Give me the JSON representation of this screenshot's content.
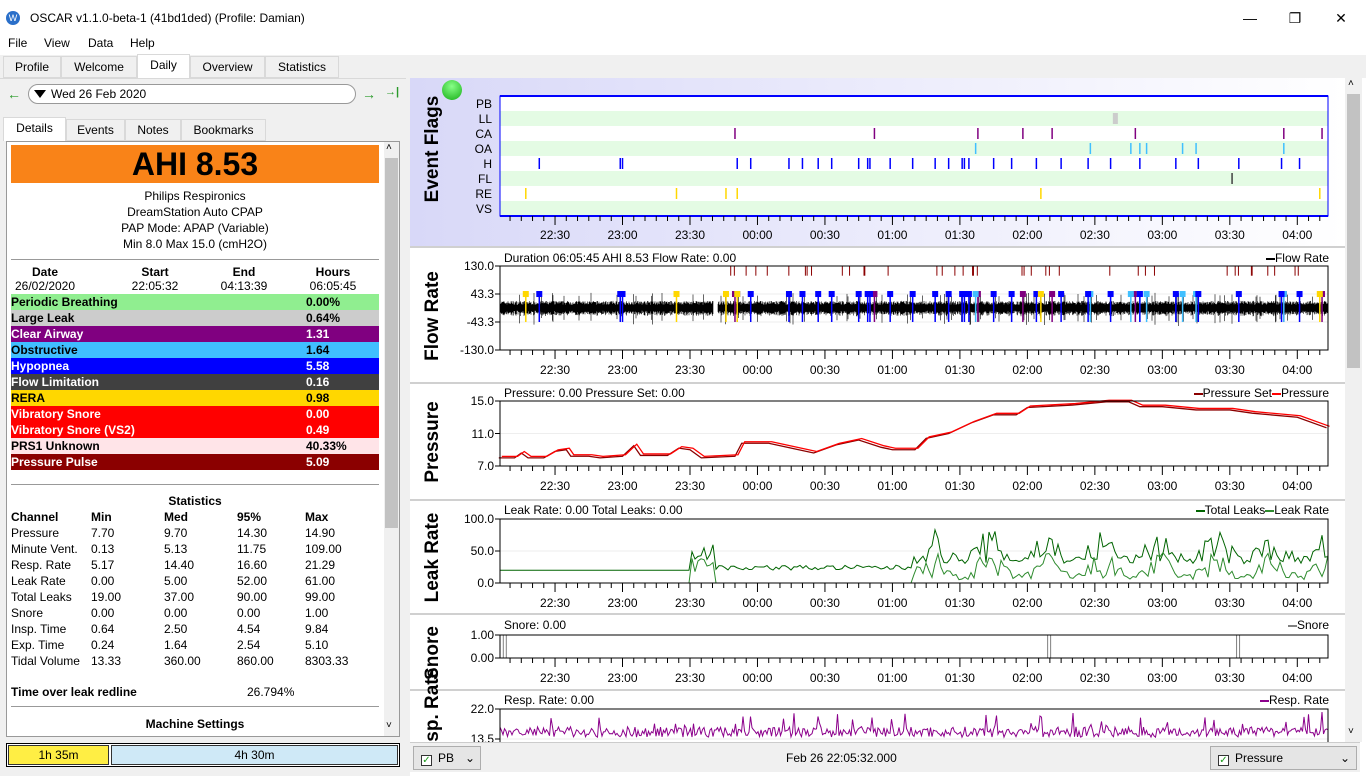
{
  "window": {
    "title": "OSCAR v1.1.0-beta-1 (41bd1ded) (Profile: Damian)",
    "minimize": "—",
    "maximize": "❐",
    "close": "✕"
  },
  "menu": [
    "File",
    "View",
    "Data",
    "Help"
  ],
  "main_tabs": [
    {
      "label": "Profile"
    },
    {
      "label": "Welcome"
    },
    {
      "label": "Daily",
      "active": true
    },
    {
      "label": "Overview"
    },
    {
      "label": "Statistics"
    }
  ],
  "date_nav": {
    "prev": "←",
    "date": "Wed 26 Feb 2020",
    "next": "→",
    "last": "→|"
  },
  "sub_tabs": [
    {
      "label": "Details",
      "active": true
    },
    {
      "label": "Events"
    },
    {
      "label": "Notes"
    },
    {
      "label": "Bookmarks"
    }
  ],
  "details": {
    "ahi": "AHI 8.53",
    "ahi_color": "#f98318",
    "machine": [
      "Philips Respironics",
      "DreamStation Auto CPAP",
      "PAP Mode: APAP (Variable)",
      "Min 8.0 Max 15.0 (cmH2O)"
    ],
    "session_headers": [
      "Date",
      "Start",
      "End",
      "Hours"
    ],
    "session_values": [
      "26/02/2020",
      "22:05:32",
      "04:13:39",
      "06:05:45"
    ],
    "events": [
      {
        "label": "Periodic Breathing",
        "value": "0.00%",
        "bg": "#90ee90",
        "fg": "#000000"
      },
      {
        "label": "Large Leak",
        "value": "0.64%",
        "bg": "#cccccc",
        "fg": "#000000"
      },
      {
        "label": "Clear Airway",
        "value": "1.31",
        "bg": "#800080",
        "fg": "#ffffff"
      },
      {
        "label": "Obstructive",
        "value": "1.64",
        "bg": "#40bfff",
        "fg": "#000000"
      },
      {
        "label": "Hypopnea",
        "value": "5.58",
        "bg": "#0000ff",
        "fg": "#ffffff"
      },
      {
        "label": "Flow Limitation",
        "value": "0.16",
        "bg": "#404040",
        "fg": "#ffffff"
      },
      {
        "label": "RERA",
        "value": "0.98",
        "bg": "#ffd700",
        "fg": "#000000"
      },
      {
        "label": "Vibratory Snore",
        "value": "0.00",
        "bg": "#ff0000",
        "fg": "#ffffff"
      },
      {
        "label": "Vibratory Snore (VS2)",
        "value": "0.49",
        "bg": "#ff0000",
        "fg": "#ffffff"
      },
      {
        "label": "PRS1 Unknown",
        "value": "40.33%",
        "bg": "#ffe4e8",
        "fg": "#000000"
      },
      {
        "label": "Pressure Pulse",
        "value": "5.09",
        "bg": "#8b0000",
        "fg": "#ffffff"
      }
    ],
    "stats_title": "Statistics",
    "stats_headers": [
      "Channel",
      "Min",
      "Med",
      "95%",
      "Max"
    ],
    "stats_rows": [
      [
        "Pressure",
        "7.70",
        "9.70",
        "14.30",
        "14.90"
      ],
      [
        "Minute Vent.",
        "0.13",
        "5.13",
        "11.75",
        "109.00"
      ],
      [
        "Resp. Rate",
        "5.17",
        "14.40",
        "16.60",
        "21.29"
      ],
      [
        "Leak Rate",
        "0.00",
        "5.00",
        "52.00",
        "61.00"
      ],
      [
        "Total Leaks",
        "19.00",
        "37.00",
        "90.00",
        "99.00"
      ],
      [
        "Snore",
        "0.00",
        "0.00",
        "0.00",
        "1.00"
      ],
      [
        "Insp. Time",
        "0.64",
        "2.50",
        "4.54",
        "9.84"
      ],
      [
        "Exp. Time",
        "0.24",
        "1.64",
        "2.54",
        "5.10"
      ],
      [
        "Tidal Volume",
        "13.33",
        "360.00",
        "860.00",
        "8303.33"
      ]
    ],
    "leak_redline_label": "Time over leak redline",
    "leak_redline_value": "26.794%",
    "machine_settings": "Machine Settings"
  },
  "session_bars": [
    {
      "label": "1h 35m",
      "color": "#ffee44"
    },
    {
      "label": "4h 30m",
      "color": "#cfe9f7"
    }
  ],
  "time_axis": {
    "start": "22:05:32",
    "end": "04:13:39",
    "labels": [
      "22:30",
      "23:00",
      "23:30",
      "00:00",
      "00:30",
      "01:00",
      "01:30",
      "02:00",
      "02:30",
      "03:00",
      "03:30",
      "04:00"
    ]
  },
  "event_flags": {
    "title": "Event Flags",
    "channels": [
      "PB",
      "LL",
      "CA",
      "OA",
      "H",
      "FL",
      "RE",
      "VS"
    ],
    "colors": {
      "CA": "#800080",
      "OA": "#40bfff",
      "H": "#0000ff",
      "FL": "#404040",
      "RE": "#ffd700",
      "LL": "#cccccc"
    },
    "events": {
      "LL": [
        "02:38"
      ],
      "CA": [
        "23:50",
        "00:52",
        "01:38",
        "01:58",
        "02:11",
        "02:48",
        "03:54",
        "04:11"
      ],
      "OA": [
        "01:37",
        "02:28",
        "02:46",
        "02:50",
        "02:53",
        "03:09",
        "03:15",
        "03:54"
      ],
      "H": [
        "22:23",
        "22:59",
        "23:00",
        "23:51",
        "23:57",
        "00:14",
        "00:20",
        "00:27",
        "00:33",
        "00:45",
        "00:49",
        "00:50",
        "00:59",
        "01:09",
        "01:19",
        "01:25",
        "01:31",
        "01:32",
        "01:34",
        "01:45",
        "01:53",
        "02:04",
        "02:15",
        "02:27",
        "02:37",
        "02:50",
        "03:06",
        "03:16",
        "03:34",
        "03:53",
        "04:01"
      ],
      "FL": [
        "03:31"
      ],
      "RE": [
        "22:17",
        "23:24",
        "23:46",
        "23:51",
        "02:06",
        "04:10"
      ]
    }
  },
  "graphs": [
    {
      "id": "flow",
      "title": "Flow Rate",
      "header": "Duration 06:05:45 AHI 8.53 Flow Rate: 0.00",
      "legend": [
        {
          "label": "Flow Rate",
          "color": "#000000"
        }
      ],
      "yticks": [
        "130.0",
        "43.3",
        "-43.3",
        "-130.0"
      ],
      "ylim": [
        -130,
        130
      ],
      "color": "#000000"
    },
    {
      "id": "pressure",
      "title": "Pressure",
      "header": "Pressure: 0.00 Pressure Set: 0.00",
      "legend": [
        {
          "label": "Pressure Set",
          "color": "#8b0000"
        },
        {
          "label": "Pressure",
          "color": "#ff0000"
        }
      ],
      "yticks": [
        "15.0",
        "11.0",
        "7.0"
      ],
      "ylim": [
        7,
        15
      ],
      "series": [
        [
          "22:05",
          8.0
        ],
        [
          "22:12",
          8.0
        ],
        [
          "22:15",
          8.6
        ],
        [
          "22:18",
          8.0
        ],
        [
          "22:25",
          8.0
        ],
        [
          "22:30",
          8.8
        ],
        [
          "22:35",
          9.0
        ],
        [
          "22:37",
          8.2
        ],
        [
          "22:45",
          8.2
        ],
        [
          "22:50",
          8.0
        ],
        [
          "23:00",
          8.2
        ],
        [
          "23:05",
          9.5
        ],
        [
          "23:08",
          8.3
        ],
        [
          "23:20",
          8.3
        ],
        [
          "23:25",
          9.2
        ],
        [
          "23:30",
          9.0
        ],
        [
          "23:35",
          8.0
        ],
        [
          "23:50",
          8.2
        ],
        [
          "23:53",
          9.8
        ],
        [
          "00:05",
          9.8
        ],
        [
          "00:15",
          9.2
        ],
        [
          "00:25",
          8.6
        ],
        [
          "00:35",
          9.6
        ],
        [
          "00:45",
          10.2
        ],
        [
          "00:55",
          9.3
        ],
        [
          "01:00",
          9.0
        ],
        [
          "01:10",
          9.0
        ],
        [
          "01:15",
          10.4
        ],
        [
          "01:25",
          11.0
        ],
        [
          "01:35",
          12.3
        ],
        [
          "01:45",
          13.3
        ],
        [
          "01:55",
          13.3
        ],
        [
          "02:00",
          14.2
        ],
        [
          "02:20",
          14.5
        ],
        [
          "02:35",
          14.9
        ],
        [
          "02:45",
          14.9
        ],
        [
          "02:50",
          14.3
        ],
        [
          "03:00",
          14.3
        ],
        [
          "03:15",
          13.9
        ],
        [
          "03:30",
          13.9
        ],
        [
          "03:40",
          13.5
        ],
        [
          "04:00",
          13.0
        ],
        [
          "04:13",
          11.7
        ]
      ]
    },
    {
      "id": "leak",
      "title": "Leak Rate",
      "header": "Leak Rate: 0.00 Total Leaks: 0.00",
      "legend": [
        {
          "label": "Total Leaks",
          "color": "#006400"
        },
        {
          "label": "Leak Rate",
          "color": "#2e8b2e"
        }
      ],
      "yticks": [
        "100.0",
        "50.0",
        "0.0"
      ],
      "ylim": [
        0,
        100
      ]
    },
    {
      "id": "snore",
      "title": "Snore",
      "header": "Snore: 0.00",
      "legend": [
        {
          "label": "Snore",
          "color": "#808080"
        }
      ],
      "yticks": [
        "1.00",
        "0.00"
      ],
      "ylim": [
        0,
        1
      ],
      "spikes": [
        "22:07",
        "02:09",
        "03:33"
      ]
    },
    {
      "id": "resp",
      "title": "Resp. Rate",
      "header": "Resp. Rate: 0.00",
      "legend": [
        {
          "label": "Resp. Rate",
          "color": "#8b008b"
        }
      ],
      "yticks": [
        "22.0",
        "13.5"
      ],
      "ylim": [
        5,
        22
      ]
    }
  ],
  "statusbar": {
    "left_combo": "PB",
    "time": "Feb 26 22:05:32.000",
    "right_combo": "Pressure"
  }
}
